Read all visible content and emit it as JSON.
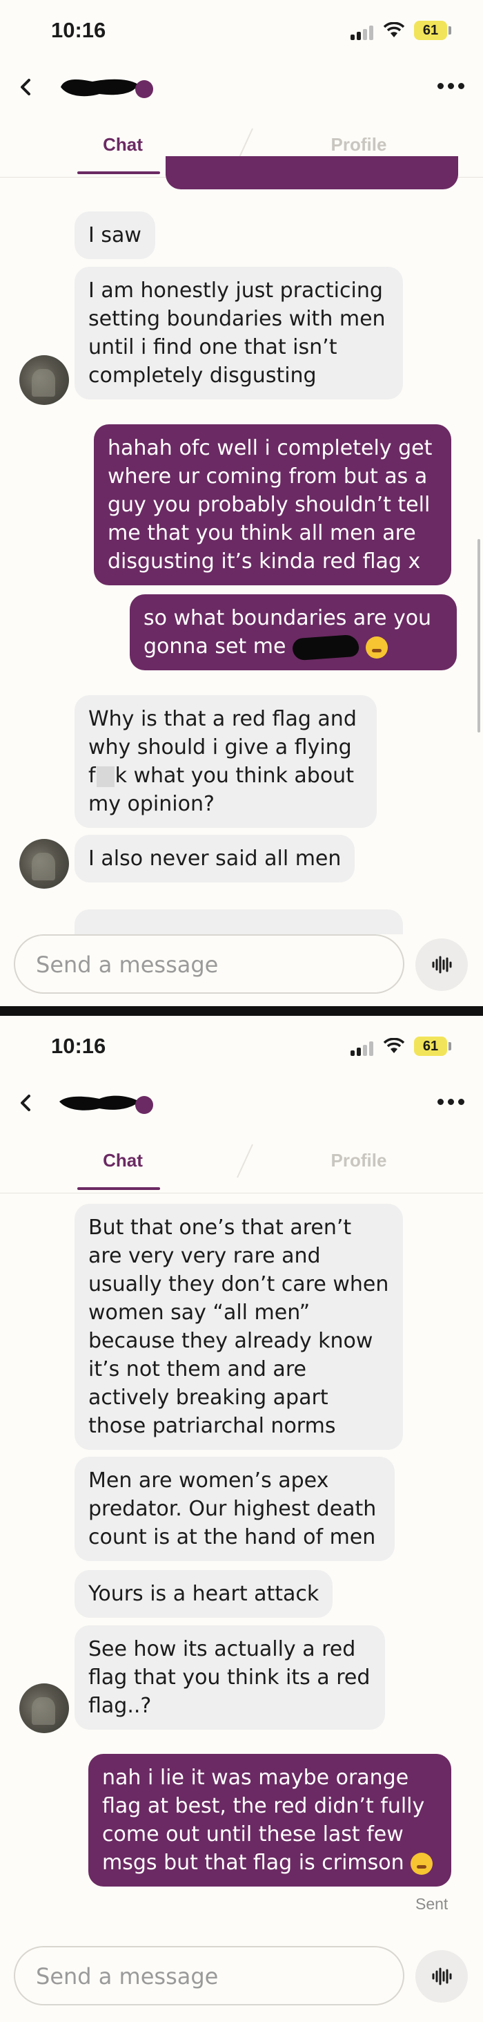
{
  "status_bar": {
    "time": "10:16",
    "battery": "61"
  },
  "header": {
    "back_icon": "chevron-left-icon",
    "more_icon": "ellipsis-icon"
  },
  "tabs": [
    {
      "label": "Chat",
      "active": true
    },
    {
      "label": "Profile",
      "active": false
    }
  ],
  "colors": {
    "accent": "#6b2a63",
    "incoming_bubble": "#efefef",
    "background": "#fdfcf8"
  },
  "screen1": {
    "messages": [
      {
        "side": "in",
        "text": "I saw"
      },
      {
        "side": "in",
        "text": "I am honestly just practicing setting boundaries with men until i find one that isn’t completely disgusting"
      },
      {
        "side": "out",
        "text": "hahah ofc well i completely get where ur coming from but as a guy you probably shouldn’t tell me that you think all men are disgusting it’s kinda red flag x"
      },
      {
        "side": "out",
        "text_before": "so what boundaries are you gonna set me"
      },
      {
        "side": "in",
        "text_before": "Why is that a red flag and why should i give a flying f",
        "text_after": "k what you think about my opinion?"
      },
      {
        "side": "in",
        "text": "I also never said all men"
      }
    ]
  },
  "screen2": {
    "messages": [
      {
        "side": "in",
        "text": "But that one’s that aren’t are very very rare and usually they don’t care when women say “all men” because they already know it’s not them and are actively breaking apart those patriarchal norms"
      },
      {
        "side": "in",
        "text": "Men are women’s apex predator. Our highest death count is at the hand of men"
      },
      {
        "side": "in",
        "text": "Yours is a heart attack"
      },
      {
        "side": "in",
        "text": "See how its actually a red flag that you think its a red flag..?"
      },
      {
        "side": "out",
        "text": "nah i lie it was maybe orange flag at best, the red didn’t fully come out until these last few msgs but that flag is crimson"
      }
    ],
    "sent_label": "Sent"
  },
  "composer": {
    "placeholder": "Send a message",
    "voice_icon": "waveform-icon"
  }
}
